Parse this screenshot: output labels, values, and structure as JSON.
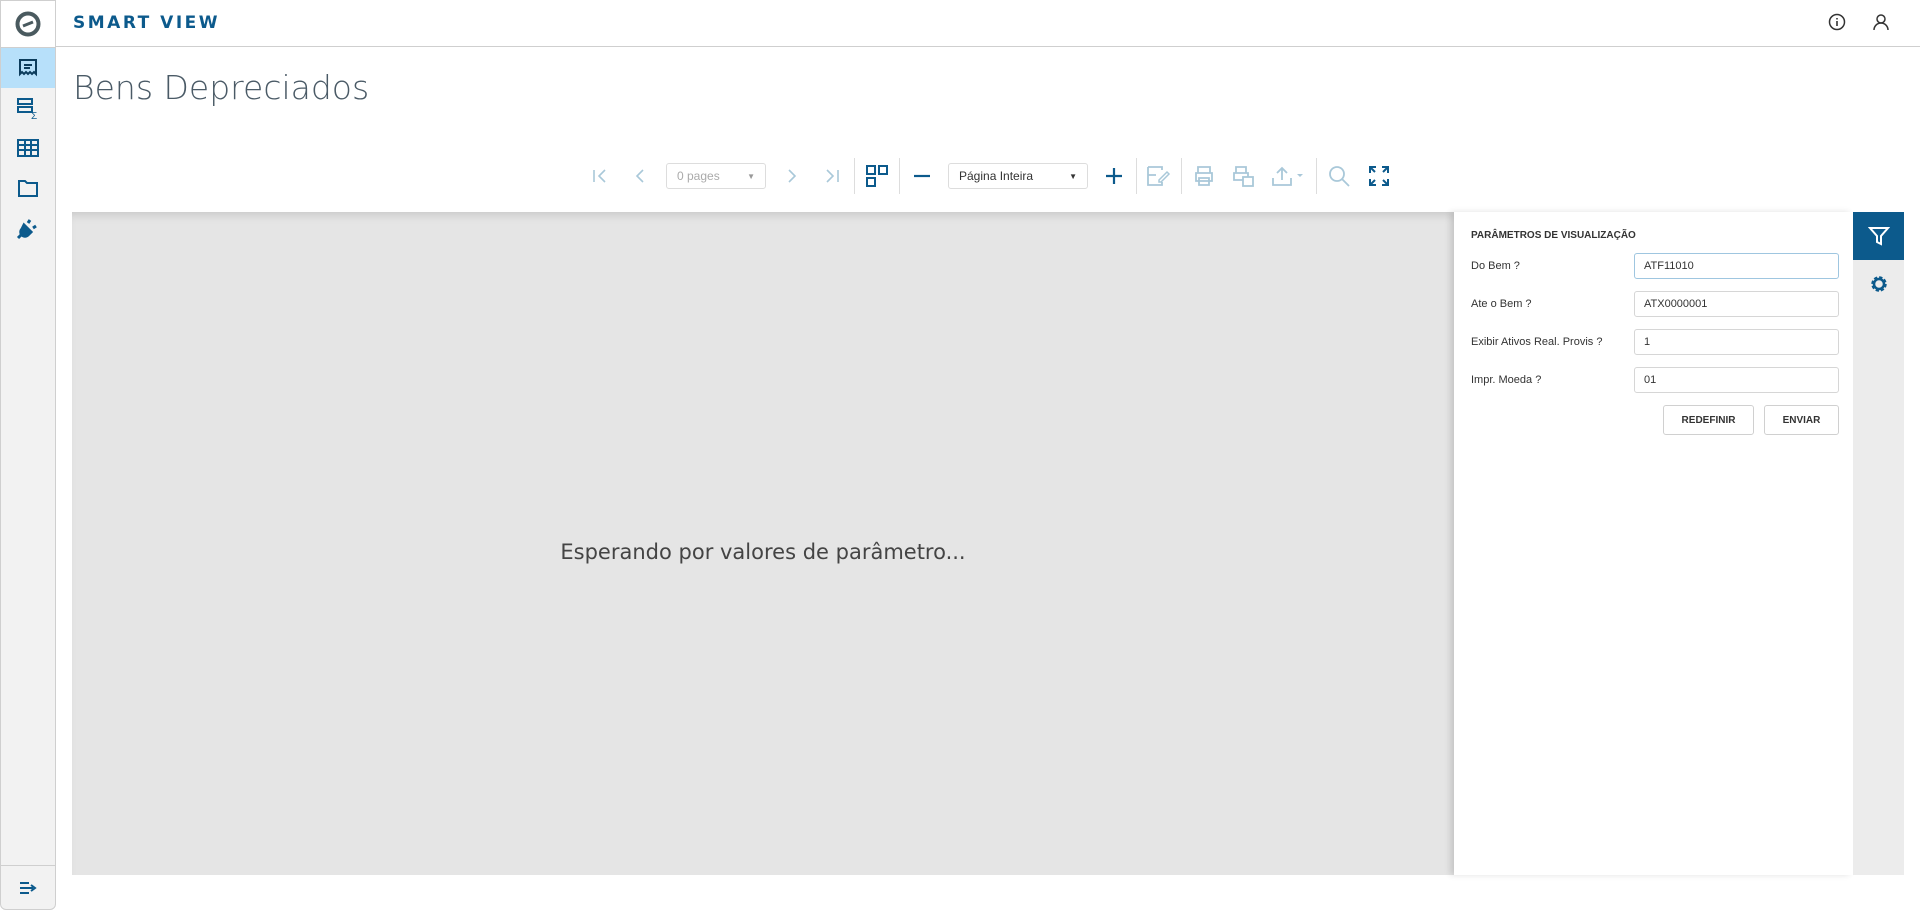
{
  "app": {
    "brand": "SMART VIEW"
  },
  "page": {
    "title": "Bens Depreciados"
  },
  "sidebar": {
    "items": [
      {
        "icon": "report-icon",
        "active": true
      },
      {
        "icon": "summary-table-icon"
      },
      {
        "icon": "grid-table-icon"
      },
      {
        "icon": "folder-icon"
      },
      {
        "icon": "plug-icon"
      }
    ],
    "collapse_icon": "expand-menu-icon"
  },
  "toolbar": {
    "pages_select": "0 pages",
    "zoom_select": "Página Inteira"
  },
  "viewer": {
    "message": "Esperando por valores de parâmetro..."
  },
  "panel": {
    "title": "PARÂMETROS DE VISUALIZAÇÃO",
    "fields": [
      {
        "label": "Do Bem ?",
        "value": "ATF11010"
      },
      {
        "label": "Ate o Bem ?",
        "value": "ATX0000001"
      },
      {
        "label": "Exibir Ativos Real. Provis ?",
        "value": "1"
      },
      {
        "label": "Impr. Moeda ?",
        "value": "01"
      }
    ],
    "reset_label": "REDEFINIR",
    "submit_label": "ENVIAR"
  },
  "colors": {
    "accent": "#0c5a8c",
    "active_sidebar": "#b7e0fa",
    "disabled_icon": "#a9c8d9"
  }
}
